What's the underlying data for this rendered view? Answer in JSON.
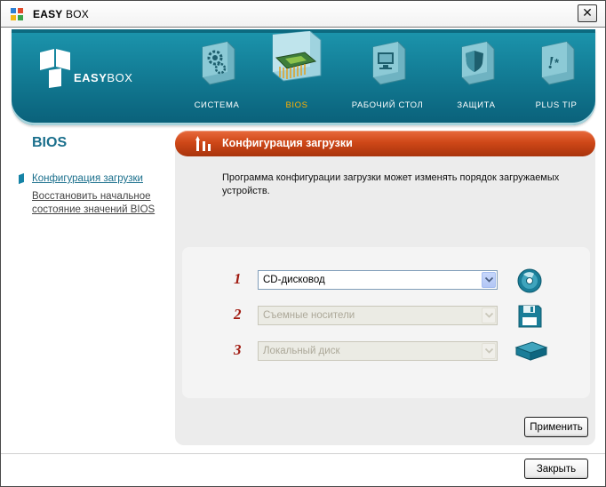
{
  "window": {
    "title_bold": "EASY",
    "title_rest": " BOX"
  },
  "brand": {
    "name_bold": "EASY",
    "name_rest": "BOX"
  },
  "nav": {
    "items": [
      {
        "label": "СИСТЕМА",
        "icon": "gears-icon"
      },
      {
        "label": "BIOS",
        "icon": "chip-icon",
        "active": true
      },
      {
        "label": "РАБОЧИЙ СТОЛ",
        "icon": "monitor-icon"
      },
      {
        "label": "ЗАЩИТА",
        "icon": "shield-icon"
      },
      {
        "label": "PLUS TIP",
        "icon": "tip-icon"
      }
    ]
  },
  "sidebar": {
    "title": "BIOS",
    "links": [
      {
        "label": "Конфигурация загрузки",
        "active": true
      },
      {
        "label": "Восстановить начальное состояние значений BIOS"
      }
    ]
  },
  "panel": {
    "title": "Конфигурация загрузки",
    "description": "Программа конфигурации загрузки может изменять порядок загружаемых устройств.",
    "rows": [
      {
        "num": "1",
        "value": "CD-дисковод",
        "enabled": true,
        "icon": "cd-icon"
      },
      {
        "num": "2",
        "value": "Съемные носители",
        "enabled": false,
        "icon": "floppy-icon"
      },
      {
        "num": "3",
        "value": "Локальный диск",
        "enabled": false,
        "icon": "hard-disk-icon"
      }
    ],
    "apply_label": "Применить"
  },
  "footer": {
    "close_label": "Закрыть"
  },
  "colors": {
    "banner": "#117891",
    "accent_orange": "#cf4818",
    "active_nav": "#ffb100",
    "link_blue": "#1a6f8c"
  }
}
